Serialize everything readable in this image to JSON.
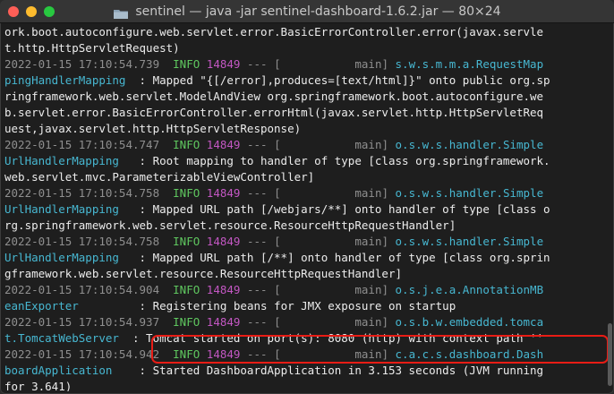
{
  "window": {
    "title": "sentinel — java -jar sentinel-dashboard-1.6.2.jar — 80×24",
    "folder_icon": "folder-icon"
  },
  "colors": {
    "timestamp": "#8f8f8f",
    "level": "#5fc75f",
    "pid": "#c357c3",
    "logger": "#47b7d1",
    "message": "#ececec",
    "highlight_border": "#e81c15"
  },
  "terminal": {
    "lines": [
      [
        {
          "text": "ork.boot.autoconfigure.web.servlet.error.BasicErrorController.error(javax.servle",
          "c": "white"
        }
      ],
      [
        {
          "text": "t.http.HttpServletRequest)",
          "c": "white"
        }
      ],
      [
        {
          "text": "2022-01-15 17:10:54.739  ",
          "c": "gray"
        },
        {
          "text": "INFO",
          "c": "green"
        },
        {
          "text": " ",
          "c": "white"
        },
        {
          "text": "14849",
          "c": "magenta"
        },
        {
          "text": " --- [           main] ",
          "c": "gray"
        },
        {
          "text": "s.w.s.m.m.a.RequestMap",
          "c": "cyan"
        }
      ],
      [
        {
          "text": "pingHandlerMapping",
          "c": "cyan"
        },
        {
          "text": "  : Mapped \"{[/error],produces=[text/html]}\" onto public org.sp",
          "c": "white"
        }
      ],
      [
        {
          "text": "ringframework.web.servlet.ModelAndView org.springframework.boot.autoconfigure.we",
          "c": "white"
        }
      ],
      [
        {
          "text": "b.servlet.error.BasicErrorController.errorHtml(javax.servlet.http.HttpServletReq",
          "c": "white"
        }
      ],
      [
        {
          "text": "uest,javax.servlet.http.HttpServletResponse)",
          "c": "white"
        }
      ],
      [
        {
          "text": "2022-01-15 17:10:54.747  ",
          "c": "gray"
        },
        {
          "text": "INFO",
          "c": "green"
        },
        {
          "text": " ",
          "c": "white"
        },
        {
          "text": "14849",
          "c": "magenta"
        },
        {
          "text": " --- [           main] ",
          "c": "gray"
        },
        {
          "text": "o.s.w.s.handler.Simple",
          "c": "cyan"
        }
      ],
      [
        {
          "text": "UrlHandlerMapping",
          "c": "cyan"
        },
        {
          "text": "   : Root mapping to handler of type [class org.springframework.",
          "c": "white"
        }
      ],
      [
        {
          "text": "web.servlet.mvc.ParameterizableViewController]",
          "c": "white"
        }
      ],
      [
        {
          "text": "2022-01-15 17:10:54.758  ",
          "c": "gray"
        },
        {
          "text": "INFO",
          "c": "green"
        },
        {
          "text": " ",
          "c": "white"
        },
        {
          "text": "14849",
          "c": "magenta"
        },
        {
          "text": " --- [           main] ",
          "c": "gray"
        },
        {
          "text": "o.s.w.s.handler.Simple",
          "c": "cyan"
        }
      ],
      [
        {
          "text": "UrlHandlerMapping",
          "c": "cyan"
        },
        {
          "text": "   : Mapped URL path [/webjars/**] onto handler of type [class o",
          "c": "white"
        }
      ],
      [
        {
          "text": "rg.springframework.web.servlet.resource.ResourceHttpRequestHandler]",
          "c": "white"
        }
      ],
      [
        {
          "text": "2022-01-15 17:10:54.758  ",
          "c": "gray"
        },
        {
          "text": "INFO",
          "c": "green"
        },
        {
          "text": " ",
          "c": "white"
        },
        {
          "text": "14849",
          "c": "magenta"
        },
        {
          "text": " --- [           main] ",
          "c": "gray"
        },
        {
          "text": "o.s.w.s.handler.Simple",
          "c": "cyan"
        }
      ],
      [
        {
          "text": "UrlHandlerMapping",
          "c": "cyan"
        },
        {
          "text": "   : Mapped URL path [/**] onto handler of type [class org.sprin",
          "c": "white"
        }
      ],
      [
        {
          "text": "gframework.web.servlet.resource.ResourceHttpRequestHandler]",
          "c": "white"
        }
      ],
      [
        {
          "text": "2022-01-15 17:10:54.904  ",
          "c": "gray"
        },
        {
          "text": "INFO",
          "c": "green"
        },
        {
          "text": " ",
          "c": "white"
        },
        {
          "text": "14849",
          "c": "magenta"
        },
        {
          "text": " --- [           main] ",
          "c": "gray"
        },
        {
          "text": "o.s.j.e.a.AnnotationMB",
          "c": "cyan"
        }
      ],
      [
        {
          "text": "eanExporter",
          "c": "cyan"
        },
        {
          "text": "         : Registering beans for JMX exposure on startup",
          "c": "white"
        }
      ],
      [
        {
          "text": "2022-01-15 17:10:54.937  ",
          "c": "gray"
        },
        {
          "text": "INFO",
          "c": "green"
        },
        {
          "text": " ",
          "c": "white"
        },
        {
          "text": "14849",
          "c": "magenta"
        },
        {
          "text": " --- [           main] ",
          "c": "gray"
        },
        {
          "text": "o.s.b.w.embedded.tomca",
          "c": "cyan"
        }
      ],
      [
        {
          "text": "t.TomcatWebServer",
          "c": "cyan"
        },
        {
          "text": "  : Tomcat started on port(s): 8080 (http) with context path ''",
          "c": "white"
        }
      ],
      [
        {
          "text": "2022-01-15 17:10:54.942  ",
          "c": "gray"
        },
        {
          "text": "INFO",
          "c": "green"
        },
        {
          "text": " ",
          "c": "white"
        },
        {
          "text": "14849",
          "c": "magenta"
        },
        {
          "text": " --- [           main] ",
          "c": "gray"
        },
        {
          "text": "c.a.c.s.dashboard.Dash",
          "c": "cyan"
        }
      ],
      [
        {
          "text": "boardApplication",
          "c": "cyan"
        },
        {
          "text": "    : Started DashboardApplication in 3.153 seconds (JVM running",
          "c": "white"
        }
      ],
      [
        {
          "text": "for 3.641)",
          "c": "white"
        }
      ],
      []
    ]
  }
}
